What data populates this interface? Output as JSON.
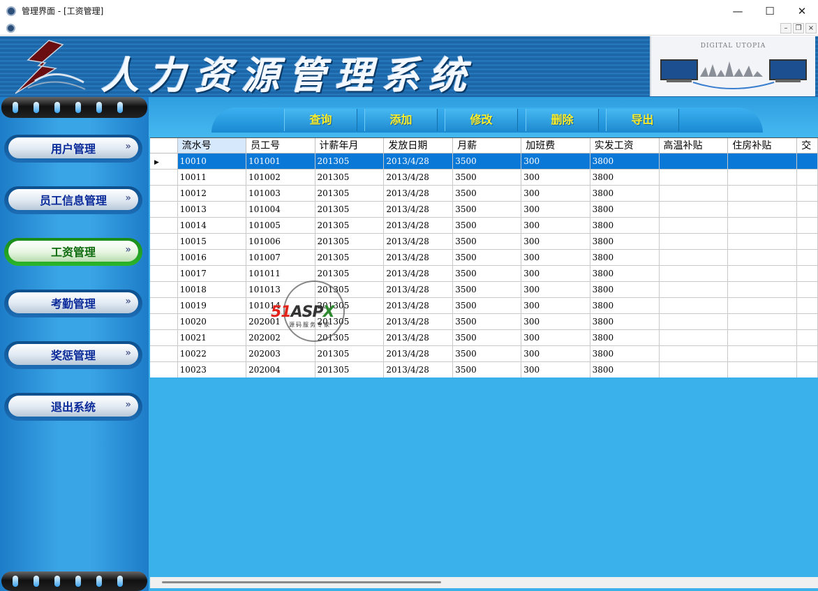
{
  "window": {
    "title": "管理界面 - [工资管理]",
    "controls": {
      "minimize": "—",
      "maximize": "☐",
      "close": "✕"
    },
    "mdi_controls": {
      "minimize": "–",
      "restore": "❐",
      "close": "×"
    }
  },
  "banner": {
    "title": "人力资源管理系统",
    "brand_text": "DIGITAL UTOPIA"
  },
  "sidebar": {
    "items": [
      {
        "label": "用户管理",
        "arrow": "»",
        "active": false
      },
      {
        "label": "员工信息管理",
        "arrow": "»",
        "active": false
      },
      {
        "label": "工资管理",
        "arrow": "»",
        "active": true
      },
      {
        "label": "考勤管理",
        "arrow": "»",
        "active": false
      },
      {
        "label": "奖惩管理",
        "arrow": "»",
        "active": false
      },
      {
        "label": "退出系统",
        "arrow": "»",
        "active": false
      }
    ]
  },
  "toolbar": {
    "query": "查询",
    "add": "添加",
    "edit": "修改",
    "delete": "删除",
    "export": "导出"
  },
  "grid": {
    "columns": [
      "流水号",
      "员工号",
      "计薪年月",
      "发放日期",
      "月薪",
      "加班费",
      "实发工资",
      "高温补贴",
      "住房补贴",
      "交"
    ],
    "rows": [
      [
        "10010",
        "101001",
        "201305",
        "2013/4/28",
        "3500",
        "300",
        "3800",
        "",
        "",
        ""
      ],
      [
        "10011",
        "101002",
        "201305",
        "2013/4/28",
        "3500",
        "300",
        "3800",
        "",
        "",
        ""
      ],
      [
        "10012",
        "101003",
        "201305",
        "2013/4/28",
        "3500",
        "300",
        "3800",
        "",
        "",
        ""
      ],
      [
        "10013",
        "101004",
        "201305",
        "2013/4/28",
        "3500",
        "300",
        "3800",
        "",
        "",
        ""
      ],
      [
        "10014",
        "101005",
        "201305",
        "2013/4/28",
        "3500",
        "300",
        "3800",
        "",
        "",
        ""
      ],
      [
        "10015",
        "101006",
        "201305",
        "2013/4/28",
        "3500",
        "300",
        "3800",
        "",
        "",
        ""
      ],
      [
        "10016",
        "101007",
        "201305",
        "2013/4/28",
        "3500",
        "300",
        "3800",
        "",
        "",
        ""
      ],
      [
        "10017",
        "101011",
        "201305",
        "2013/4/28",
        "3500",
        "300",
        "3800",
        "",
        "",
        ""
      ],
      [
        "10018",
        "101013",
        "201305",
        "2013/4/28",
        "3500",
        "300",
        "3800",
        "",
        "",
        ""
      ],
      [
        "10019",
        "101014",
        "201305",
        "2013/4/28",
        "3500",
        "300",
        "3800",
        "",
        "",
        ""
      ],
      [
        "10020",
        "202001",
        "201305",
        "2013/4/28",
        "3500",
        "300",
        "3800",
        "",
        "",
        ""
      ],
      [
        "10021",
        "202002",
        "201305",
        "2013/4/28",
        "3500",
        "300",
        "3800",
        "",
        "",
        ""
      ],
      [
        "10022",
        "202003",
        "201305",
        "2013/4/28",
        "3500",
        "300",
        "3800",
        "",
        "",
        ""
      ],
      [
        "10023",
        "202004",
        "201305",
        "2013/4/28",
        "3500",
        "300",
        "3800",
        "",
        "",
        ""
      ]
    ],
    "selected_row": 0,
    "row_pointer": "▶"
  },
  "watermark": {
    "brand_51": "51",
    "brand_asp": "ASP",
    "brand_x": "X",
    "subtitle": "源码服务专家"
  },
  "colors": {
    "banner": "#1f6fb3",
    "sidebar": "#3aa5e6",
    "main_bg": "#3ab1ea",
    "toolbar_text": "#ffef29",
    "selected_row": "#0a78d7",
    "active_nav": "#2bb52b"
  }
}
